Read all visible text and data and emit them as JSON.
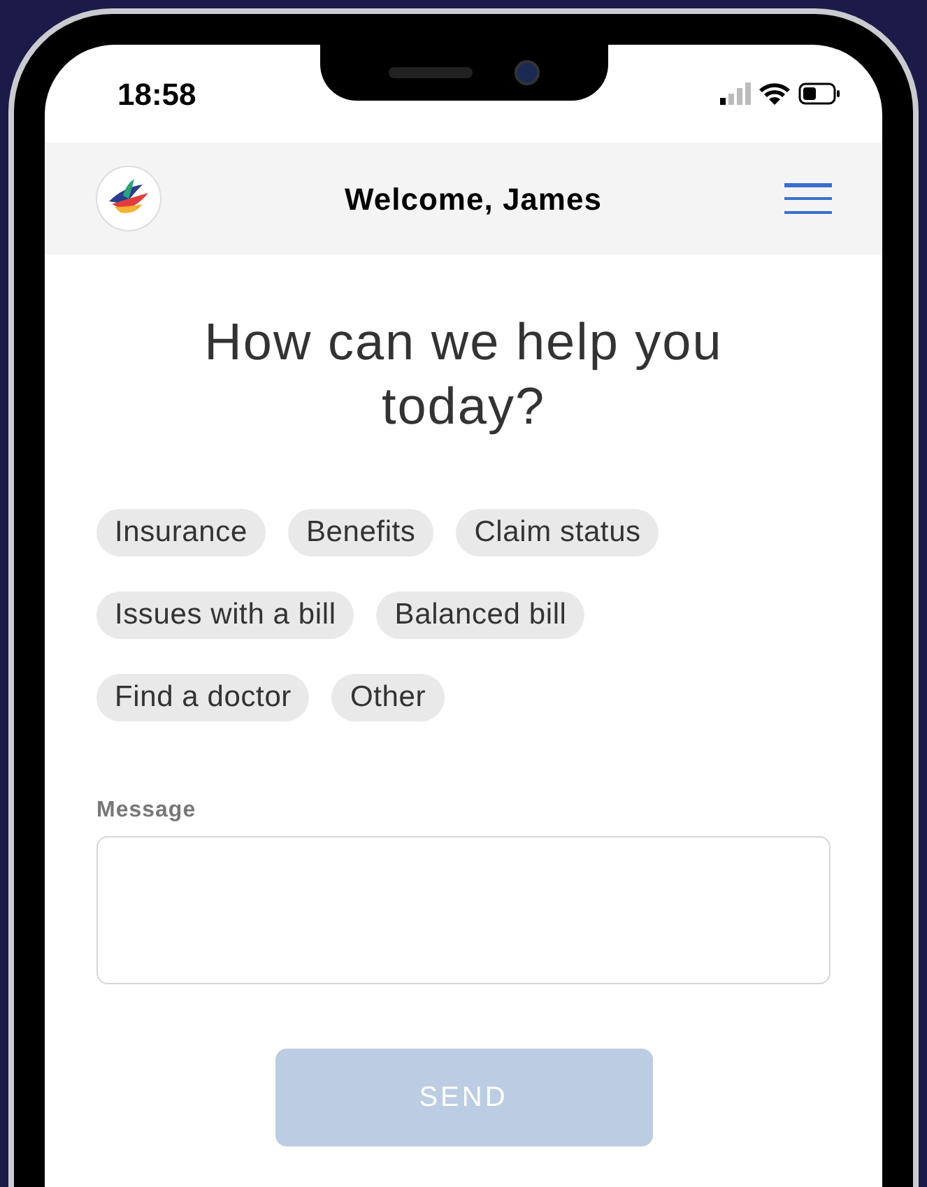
{
  "status_bar": {
    "time": "18:58"
  },
  "header": {
    "title": "Welcome, James"
  },
  "heading": "How can we help you today?",
  "topics": [
    {
      "label": "Insurance"
    },
    {
      "label": "Benefits"
    },
    {
      "label": "Claim status"
    },
    {
      "label": "Issues with a bill"
    },
    {
      "label": "Balanced bill"
    },
    {
      "label": "Find a doctor"
    },
    {
      "label": "Other"
    }
  ],
  "message": {
    "label": "Message"
  },
  "send_button": {
    "label": "SEND",
    "disabled": true
  }
}
